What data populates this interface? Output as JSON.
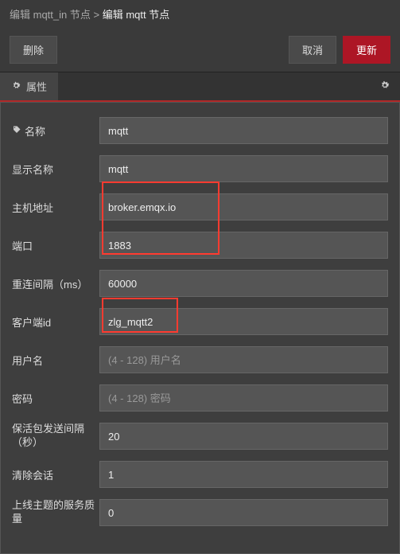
{
  "breadcrumb": {
    "parent": "编辑 mqtt_in 节点",
    "separator": ">",
    "current": "编辑 mqtt 节点"
  },
  "toolbar": {
    "delete_label": "删除",
    "cancel_label": "取消",
    "update_label": "更新"
  },
  "tabs": {
    "properties_label": "属性"
  },
  "form": {
    "name_label": "名称",
    "name_value": "mqtt",
    "display_name_label": "显示名称",
    "display_name_value": "mqtt",
    "host_label": "主机地址",
    "host_value": "broker.emqx.io",
    "port_label": "端口",
    "port_value": "1883",
    "reconnect_label": "重连间隔（ms）",
    "reconnect_value": "60000",
    "client_id_label": "客户端id",
    "client_id_value": "zlg_mqtt2",
    "username_label": "用户名",
    "username_placeholder": "(4 - 128) 用户名",
    "username_value": "",
    "password_label": "密码",
    "password_placeholder": "(4 - 128) 密码",
    "password_value": "",
    "keepalive_label": "保活包发送间隔（秒）",
    "keepalive_value": "20",
    "clean_session_label": "清除会话",
    "clean_session_value": "1",
    "birth_qos_label": "上线主题的服务质量",
    "birth_qos_value": "0"
  }
}
